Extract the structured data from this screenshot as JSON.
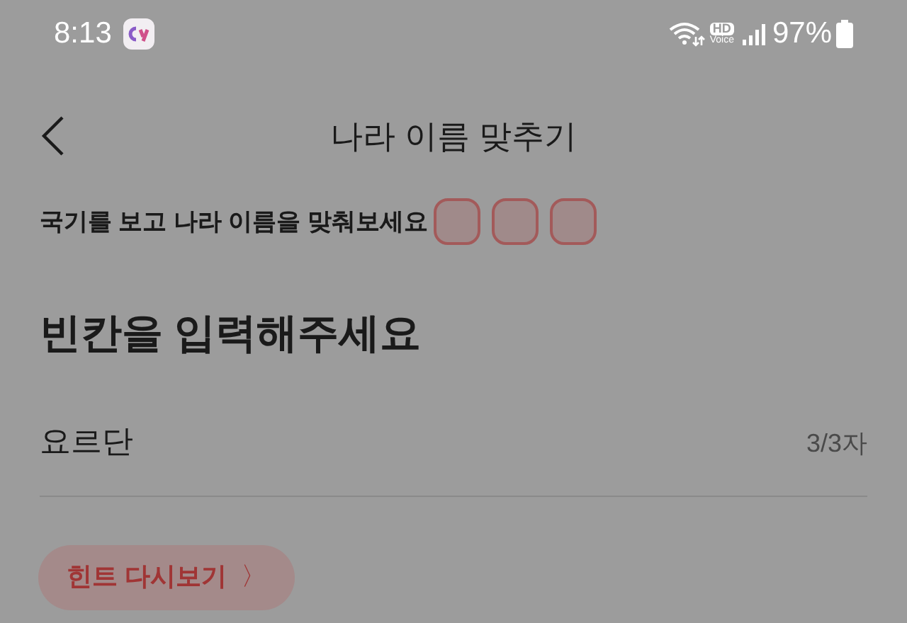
{
  "status_bar": {
    "time": "8:13",
    "battery": "97%",
    "hd_label": "HD",
    "voice_label": "Voice"
  },
  "header": {
    "title": "나라 이름 맞추기"
  },
  "instruction": {
    "text": "국기를 보고 나라 이름을 맞춰보세요",
    "slots": [
      {
        "filled": false
      },
      {
        "filled": false
      },
      {
        "filled": false
      }
    ]
  },
  "heading": "빈칸을 입력해주세요",
  "answer": {
    "value": "요르단",
    "counter": "3/3자"
  },
  "hint_button": {
    "label": "힌트 다시보기",
    "arrow": "〉"
  }
}
